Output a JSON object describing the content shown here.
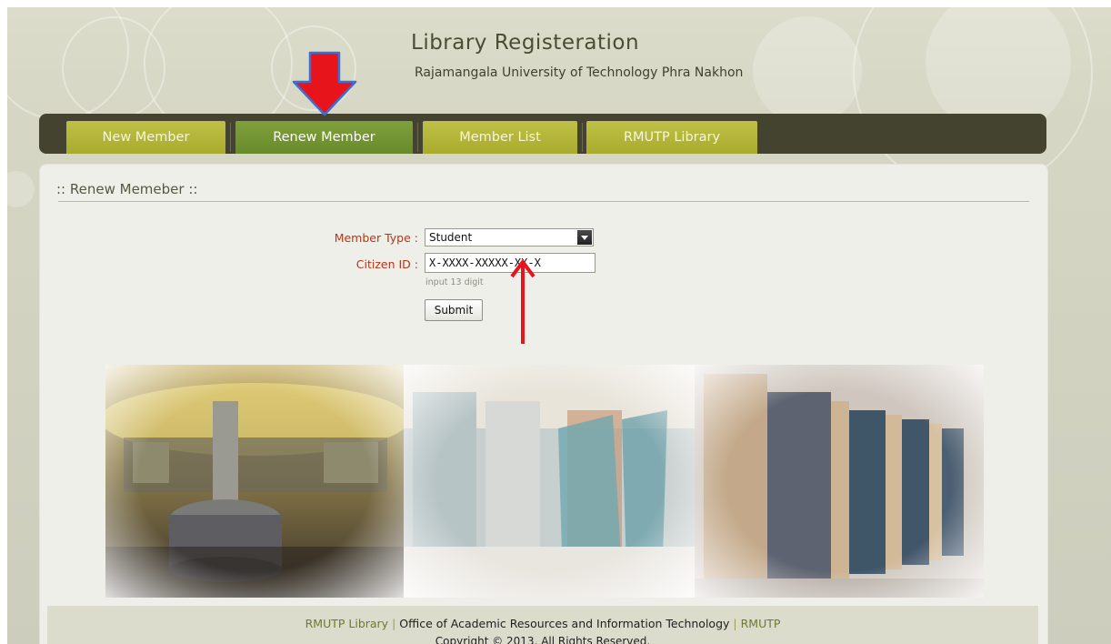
{
  "header": {
    "title": "Library Registeration",
    "subtitle": "Rajamangala University of Technology Phra Nakhon"
  },
  "nav": {
    "items": [
      {
        "label": "New Member",
        "active": false
      },
      {
        "label": "Renew Member",
        "active": true
      },
      {
        "label": "Member List",
        "active": false
      },
      {
        "label": "RMUTP Library",
        "active": false
      }
    ]
  },
  "form": {
    "section_title": ":: Renew Memeber ::",
    "member_type_label": "Member Type :",
    "member_type_value": "Student",
    "citizen_id_label": "Citizen ID :",
    "citizen_id_value": "X-XXXX-XXXXX-XX-X",
    "citizen_id_hint": "input 13 digit",
    "submit_label": "Submit"
  },
  "footer": {
    "link_library": "RMUTP Library",
    "separator": "|",
    "office": "Office of Academic Resources and Information Technology",
    "link_rmutp": "RMUTP",
    "copyright": "Copyright © 2013. All Rights Reserved."
  },
  "colors": {
    "nav_bar": "#43432f",
    "nav_tab": "#b5b63a",
    "nav_tab_active": "#75962f",
    "label_red": "#b2361b",
    "annotation_red": "#e8141b",
    "annotation_outline": "#3a6fd8"
  }
}
